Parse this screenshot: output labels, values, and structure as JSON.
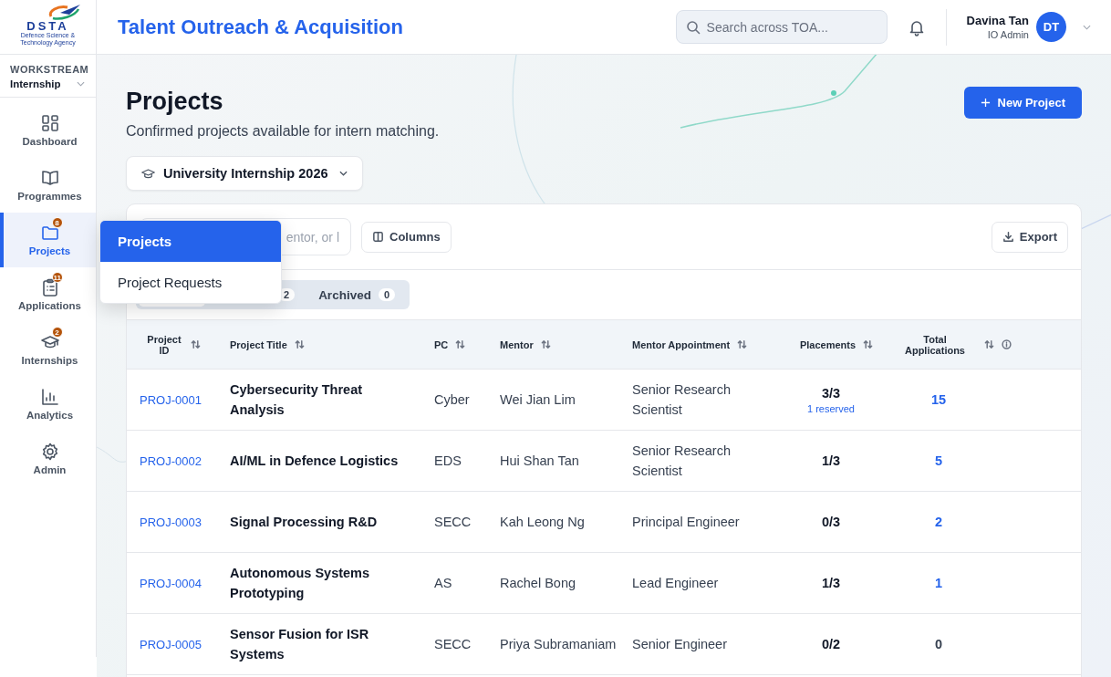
{
  "logo": {
    "text": "DSTA",
    "subtitle": "Defence Science & Technology Agency"
  },
  "app_title": "Talent Outreach & Acquisition",
  "search": {
    "placeholder": "Search across TOA..."
  },
  "user": {
    "name": "Davina Tan",
    "role": "IO Admin",
    "initials": "DT"
  },
  "workstream": {
    "label": "WORKSTREAM",
    "value": "Internship"
  },
  "sidebar": {
    "items": [
      {
        "label": "Dashboard",
        "selected": false
      },
      {
        "label": "Programmes",
        "selected": false
      },
      {
        "label": "Projects",
        "badge": "8",
        "selected": true
      },
      {
        "label": "Applications",
        "badge": "11",
        "selected": false
      },
      {
        "label": "Internships",
        "badge": "2",
        "selected": false
      },
      {
        "label": "Analytics",
        "selected": false
      },
      {
        "label": "Admin",
        "selected": false
      }
    ]
  },
  "flyout_menu": {
    "items": [
      {
        "label": "Projects",
        "selected": true
      },
      {
        "label": "Project Requests",
        "selected": false
      }
    ]
  },
  "page": {
    "title": "Projects",
    "subtitle": "Confirmed projects available for intern matching.",
    "new_button": "New Project",
    "programme": "University Internship 2026"
  },
  "toolbar": {
    "search_placeholder": "entor, or l",
    "columns_button": "Columns",
    "export_button": "Export"
  },
  "status_tabs": [
    {
      "count": "2",
      "selected": false
    },
    {
      "label": "Archived",
      "count": "0",
      "selected": false
    }
  ],
  "table": {
    "columns": [
      {
        "label": "Project ID",
        "info": false
      },
      {
        "label": "Project Title",
        "info": false
      },
      {
        "label": "PC",
        "info": false
      },
      {
        "label": "Mentor",
        "info": false
      },
      {
        "label": "Mentor Appointment",
        "info": false
      },
      {
        "label": "Placements",
        "info": false
      },
      {
        "label": "Total Applications",
        "info": true
      }
    ],
    "rows": [
      {
        "id": "PROJ-0001",
        "title": "Cybersecurity Threat Analysis",
        "pc": "Cyber",
        "mentor": "Wei Jian Lim",
        "appointment": "Senior Research Scientist",
        "placements": "3/3",
        "reserved": "1 reserved",
        "applications": "15",
        "linked": true
      },
      {
        "id": "PROJ-0002",
        "title": "AI/ML in Defence Logistics",
        "pc": "EDS",
        "mentor": "Hui Shan Tan",
        "appointment": "Senior Research Scientist",
        "placements": "1/3",
        "applications": "5",
        "linked": true
      },
      {
        "id": "PROJ-0003",
        "title": "Signal Processing R&D",
        "pc": "SECC",
        "mentor": "Kah Leong Ng",
        "appointment": "Principal Engineer",
        "placements": "0/3",
        "applications": "2",
        "linked": true
      },
      {
        "id": "PROJ-0004",
        "title": "Autonomous Systems Prototyping",
        "pc": "AS",
        "mentor": "Rachel Bong",
        "appointment": "Lead Engineer",
        "placements": "1/3",
        "applications": "1",
        "linked": true
      },
      {
        "id": "PROJ-0005",
        "title": "Sensor Fusion for ISR Systems",
        "pc": "SECC",
        "mentor": "Priya Subramaniam",
        "appointment": "Senior Engineer",
        "placements": "0/2",
        "applications": "0",
        "linked": false
      }
    ]
  }
}
